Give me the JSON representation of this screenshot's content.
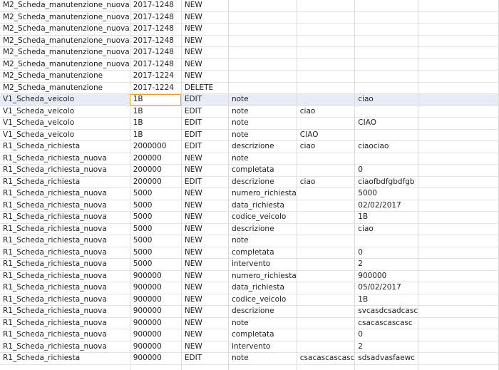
{
  "rows": [
    [
      "M2_Scheda_manutenzione_nuova",
      "2017-1248",
      "NEW",
      "",
      "",
      "",
      ""
    ],
    [
      "M2_Scheda_manutenzione_nuova",
      "2017-1248",
      "NEW",
      "",
      "",
      "",
      ""
    ],
    [
      "M2_Scheda_manutenzione_nuova",
      "2017-1248",
      "NEW",
      "",
      "",
      "",
      ""
    ],
    [
      "M2_Scheda_manutenzione_nuova",
      "2017-1248",
      "NEW",
      "",
      "",
      "",
      ""
    ],
    [
      "M2_Scheda_manutenzione_nuova",
      "2017-1248",
      "NEW",
      "",
      "",
      "",
      ""
    ],
    [
      "M2_Scheda_manutenzione_nuova",
      "2017-1248",
      "NEW",
      "",
      "",
      "",
      ""
    ],
    [
      "M2_Scheda_manutenzione",
      "2017-1224",
      "NEW",
      "",
      "",
      "",
      ""
    ],
    [
      "M2_Scheda_manutenzione",
      "2017-1224",
      "DELETE",
      "",
      "",
      "",
      ""
    ],
    [
      "V1_Scheda_veicolo",
      "1B",
      "EDIT",
      "note",
      "",
      "ciao",
      ""
    ],
    [
      "V1_Scheda_veicolo",
      "1B",
      "EDIT",
      "note",
      "ciao",
      "",
      ""
    ],
    [
      "V1_Scheda_veicolo",
      "1B",
      "EDIT",
      "note",
      "",
      "CIAO",
      ""
    ],
    [
      "V1_Scheda_veicolo",
      "1B",
      "EDIT",
      "note",
      "CIAO",
      "",
      ""
    ],
    [
      "R1_Scheda_richiesta",
      "2000000",
      "EDIT",
      "descrizione",
      "ciao",
      "ciaociao",
      ""
    ],
    [
      "R1_Scheda_richiesta_nuova",
      "200000",
      "NEW",
      "note",
      "",
      "",
      ""
    ],
    [
      "R1_Scheda_richiesta_nuova",
      "200000",
      "NEW",
      "completata",
      "",
      "0",
      ""
    ],
    [
      "R1_Scheda_richiesta",
      "200000",
      "EDIT",
      "descrizione",
      "ciao",
      "ciaofbdfgbdfgb",
      ""
    ],
    [
      "R1_Scheda_richiesta_nuova",
      "5000",
      "NEW",
      "numero_richiesta",
      "",
      "5000",
      ""
    ],
    [
      "R1_Scheda_richiesta_nuova",
      "5000",
      "NEW",
      "data_richiesta",
      "",
      "02/02/2017",
      ""
    ],
    [
      "R1_Scheda_richiesta_nuova",
      "5000",
      "NEW",
      "codice_veicolo",
      "",
      "1B",
      ""
    ],
    [
      "R1_Scheda_richiesta_nuova",
      "5000",
      "NEW",
      "descrizione",
      "",
      "ciao",
      ""
    ],
    [
      "R1_Scheda_richiesta_nuova",
      "5000",
      "NEW",
      "note",
      "",
      "",
      ""
    ],
    [
      "R1_Scheda_richiesta_nuova",
      "5000",
      "NEW",
      "completata",
      "",
      "0",
      ""
    ],
    [
      "R1_Scheda_richiesta_nuova",
      "5000",
      "NEW",
      "intervento",
      "",
      "2",
      ""
    ],
    [
      "R1_Scheda_richiesta_nuova",
      "900000",
      "NEW",
      "numero_richiesta",
      "",
      "900000",
      ""
    ],
    [
      "R1_Scheda_richiesta_nuova",
      "900000",
      "NEW",
      "data_richiesta",
      "",
      "05/02/2017",
      ""
    ],
    [
      "R1_Scheda_richiesta_nuova",
      "900000",
      "NEW",
      "codice_veicolo",
      "",
      "1B",
      ""
    ],
    [
      "R1_Scheda_richiesta_nuova",
      "900000",
      "NEW",
      "descrizione",
      "",
      "svcasdcsadcasc",
      ""
    ],
    [
      "R1_Scheda_richiesta_nuova",
      "900000",
      "NEW",
      "note",
      "",
      "csacascascasc",
      ""
    ],
    [
      "R1_Scheda_richiesta_nuova",
      "900000",
      "NEW",
      "completata",
      "",
      "0",
      ""
    ],
    [
      "R1_Scheda_richiesta_nuova",
      "900000",
      "NEW",
      "intervento",
      "",
      "2",
      ""
    ],
    [
      "R1_Scheda_richiesta",
      "900000",
      "EDIT",
      "note",
      "csacascascasc",
      "sdsadvasfaewc",
      ""
    ],
    [
      "",
      "",
      "",
      "",
      "",
      "",
      ""
    ],
    [
      "",
      "",
      "",
      "",
      "",
      "",
      ""
    ]
  ],
  "active_row": 8,
  "selected_col": 1,
  "colors": {
    "active_row": "#e8ecf6",
    "selection": "#e8a13a",
    "gridline": "#d9d9d9"
  }
}
